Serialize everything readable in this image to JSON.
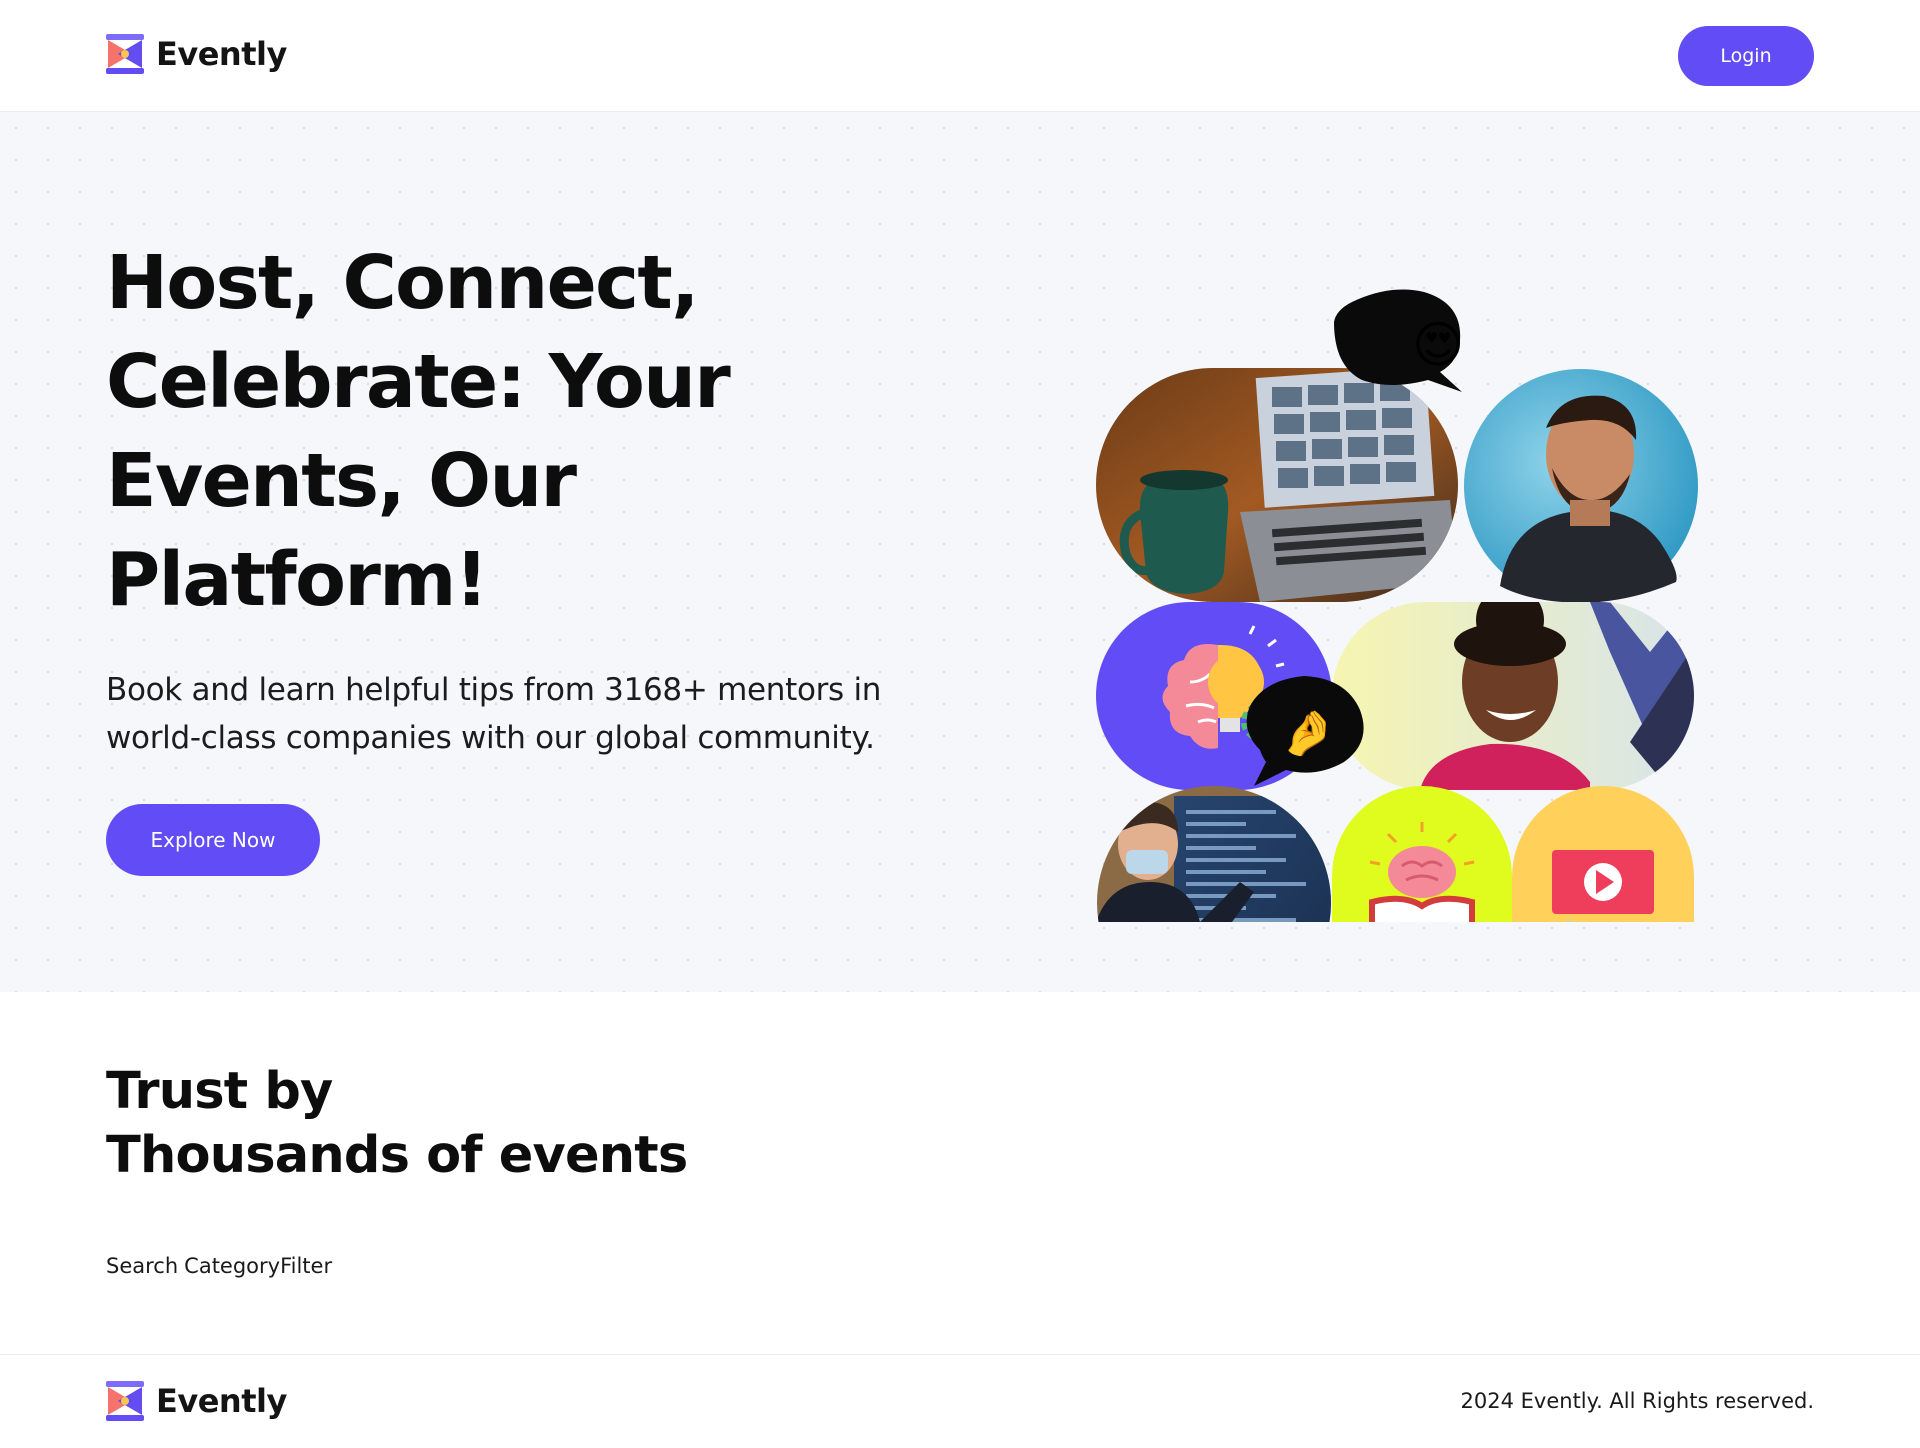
{
  "header": {
    "brand": "Evently",
    "login_label": "Login"
  },
  "hero": {
    "title": "Host, Connect, Celebrate: Your Events, Our Platform!",
    "subtitle": "Book and learn helpful tips from 3168+ mentors in world-class companies with our global community.",
    "cta_label": "Explore Now",
    "emoji_top": "😍",
    "emoji_bottom": "🤌"
  },
  "trust": {
    "title_line1": "Trust by",
    "title_line2": "Thousands of events"
  },
  "filters": {
    "search_label": "Search",
    "category_label": "CategoryFilter"
  },
  "footer": {
    "brand": "Evently",
    "copyright": "2024 Evently. All Rights reserved."
  },
  "colors": {
    "primary": "#624cf5",
    "hero_bg": "#f6f7fb",
    "lime": "#e0fb1e",
    "yellow": "#ffd05a"
  },
  "icons": [
    "evently-logo-icon",
    "brain-bulb-icon",
    "brain-book-icon",
    "video-play-icon"
  ]
}
